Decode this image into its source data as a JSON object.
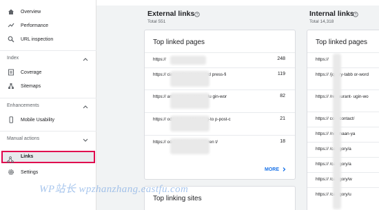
{
  "sidebar": {
    "items_top": [
      {
        "label": "Overview",
        "icon": "home-icon"
      },
      {
        "label": "Performance",
        "icon": "trend-icon"
      },
      {
        "label": "URL inspection",
        "icon": "search-icon"
      }
    ],
    "index": {
      "title": "Index",
      "items": [
        {
          "label": "Coverage"
        },
        {
          "label": "Sitemaps"
        }
      ]
    },
    "enhancements": {
      "title": "Enhancements",
      "items": [
        {
          "label": "Mobile Usability"
        }
      ]
    },
    "manual_actions": {
      "title": "Manual actions"
    },
    "links": {
      "label": "Links"
    },
    "settings": {
      "label": "Settings"
    }
  },
  "external": {
    "title": "External links",
    "total": "Total 551",
    "card_title": "Top linked pages",
    "rows": [
      {
        "url": "https://",
        "count": "248"
      },
      {
        "url": "https://                         cial-media-plugin-word press-fi",
        "count": "119"
      },
      {
        "url": "https://                         ant-menu-manager-plu gin-wor",
        "count": "82"
      },
      {
        "url": "https://                         ode-output-appearing-to p-post-c",
        "count": "21"
      },
      {
        "url": "https://                         oogle-chrome-is-differen t/",
        "count": "18"
      }
    ],
    "more": "MORE",
    "next_card_title": "Top linking sites"
  },
  "internal": {
    "title": "Internal links",
    "total": "Total 14,318",
    "card_title": "Top linked pages",
    "rows": [
      {
        "url": "https://"
      },
      {
        "url": "https://         /jquery-tabb or-word"
      },
      {
        "url": "https://         /restaurant- ugin-wo"
      },
      {
        "url": "https://         com/contact/"
      },
      {
        "url": "https://         /noumaan-ya"
      },
      {
        "url": "https://         /category/a"
      },
      {
        "url": "https://         /category/a"
      },
      {
        "url": "https://         /category/w"
      },
      {
        "url": "https://         /category/u"
      }
    ]
  },
  "watermark": "WP站长 wpzhanzhang.eastfu.com"
}
